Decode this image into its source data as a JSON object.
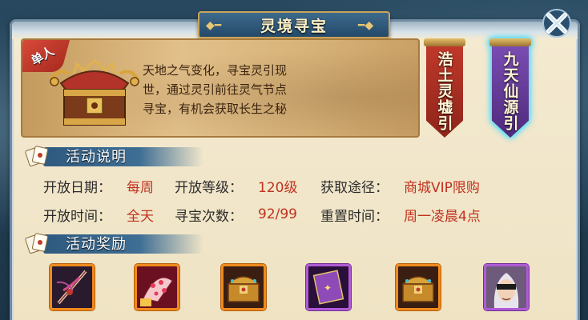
{
  "window": {
    "title": "灵境寻宝"
  },
  "banner": {
    "badge": "单人",
    "description_lines": [
      "天地之气变化，寻宝灵引现",
      "世，通过灵引前往灵气节点",
      "寻宝，有机会获取长生之秘"
    ]
  },
  "tabs": [
    {
      "label": "浩土灵墟引",
      "color": "#c0392b",
      "selected": false
    },
    {
      "label": "九天仙源引",
      "color": "#7b4db3",
      "selected": true
    }
  ],
  "sections": {
    "description_header": "活动说明",
    "rewards_header": "活动奖励"
  },
  "info": {
    "open_date_label": "开放日期：",
    "open_date_value": "每周",
    "open_level_label": "开放等级：",
    "open_level_value": "120级",
    "acquire_label": "获取途径：",
    "acquire_value": "商城VIP限购",
    "open_time_label": "开放时间：",
    "open_time_value": "全天",
    "treasure_count_label": "寻宝次数：",
    "treasure_count_value": "92/99",
    "reset_time_label": "重置时间：",
    "reset_time_value": "周一凌晨4点"
  },
  "rewards": [
    {
      "icon": "weapon-icon",
      "rarity": "orange"
    },
    {
      "icon": "fan-icon",
      "rarity": "orange"
    },
    {
      "icon": "treasure-chest-icon",
      "rarity": "orange"
    },
    {
      "icon": "scroll-icon",
      "rarity": "purple"
    },
    {
      "icon": "treasure-chest-icon",
      "rarity": "orange"
    },
    {
      "icon": "masked-character-icon",
      "rarity": "purple"
    }
  ],
  "colors": {
    "accent_red": "#c0321f",
    "header_blue": "#2f5a80",
    "panel_bg": "#f4ead1",
    "glow_cyan": "#56e3ff"
  }
}
